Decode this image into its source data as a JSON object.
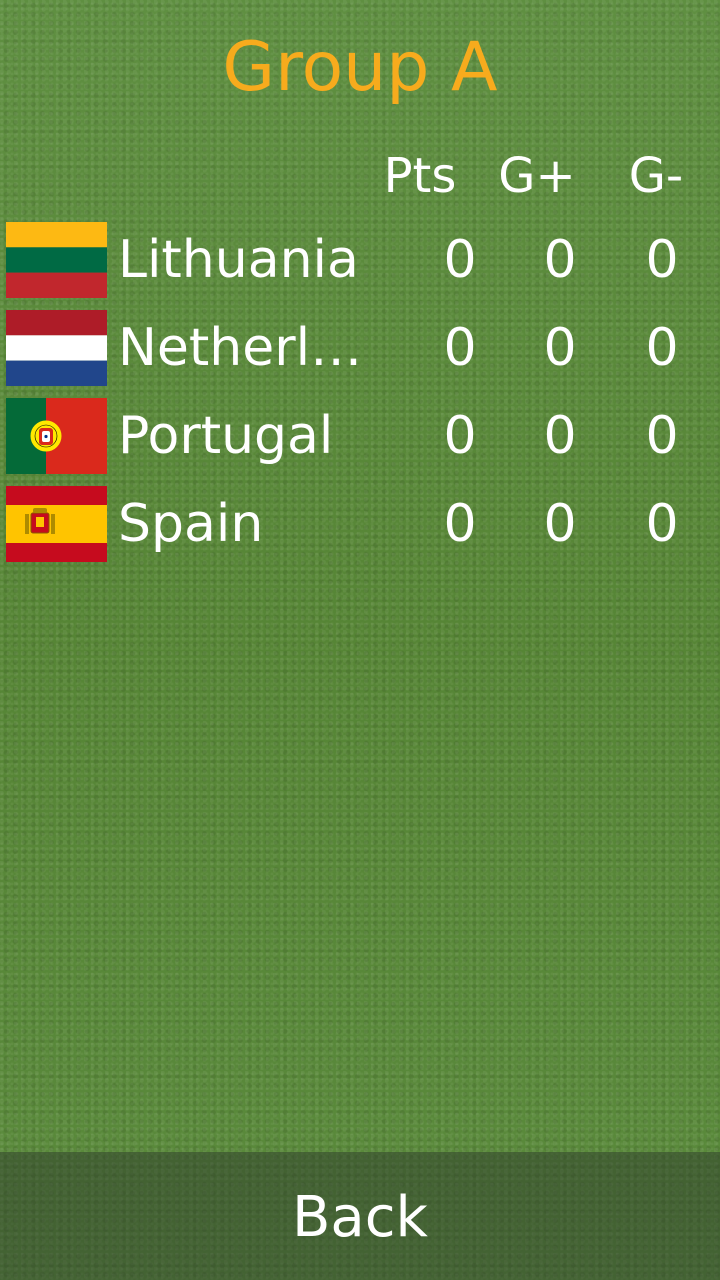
{
  "title": "Group A",
  "colors": {
    "title": "#f7ab1d",
    "text": "#ffffff"
  },
  "columns": {
    "pts": "Pts",
    "goals_for": "G+",
    "goals_against": "G-"
  },
  "teams": [
    {
      "name": "Lithuania",
      "flag": "lithuania-flag-icon",
      "pts": "0",
      "goals_for": "0",
      "goals_against": "0"
    },
    {
      "name": "Netherlan..",
      "flag": "netherlands-flag-icon",
      "pts": "0",
      "goals_for": "0",
      "goals_against": "0"
    },
    {
      "name": "Portugal",
      "flag": "portugal-flag-icon",
      "pts": "0",
      "goals_for": "0",
      "goals_against": "0"
    },
    {
      "name": "Spain",
      "flag": "spain-flag-icon",
      "pts": "0",
      "goals_for": "0",
      "goals_against": "0"
    }
  ],
  "back_label": "Back"
}
